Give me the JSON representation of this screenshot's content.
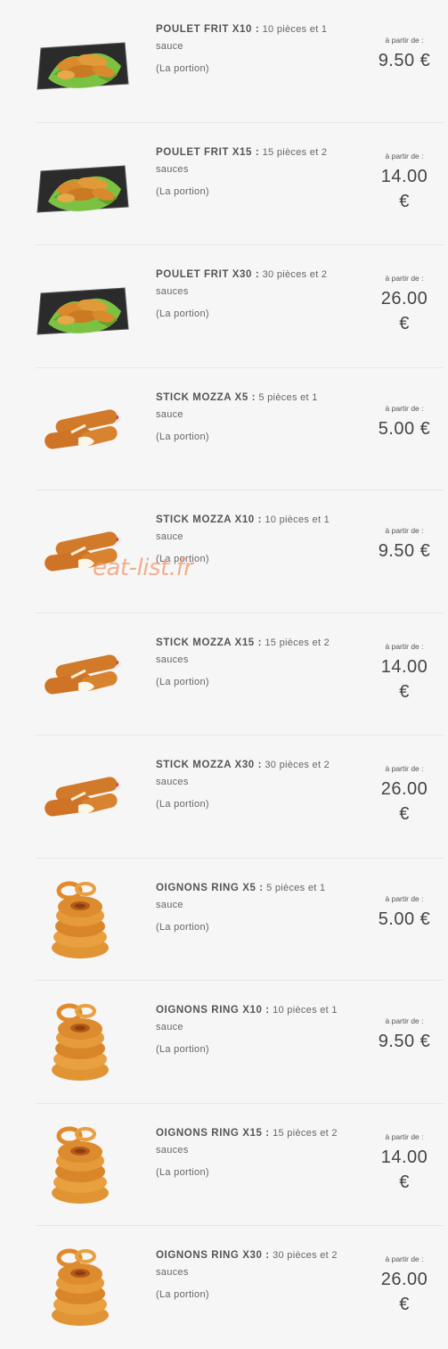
{
  "items": [
    {
      "name": "POULET FRIT X10 :",
      "detail": " 10 pièces et 1 sauce",
      "portion": "(La portion)",
      "from": "à partir de :",
      "price": "9.50 €",
      "image": "fried-chicken"
    },
    {
      "name": "POULET FRIT X15 :",
      "detail": " 15 pièces et 2 sauces",
      "portion": "(La portion)",
      "from": "à partir de :",
      "price": "14.00 €",
      "image": "fried-chicken"
    },
    {
      "name": "POULET FRIT X30 :",
      "detail": " 30 pièces et 2 sauces",
      "portion": "(La portion)",
      "from": "à partir de :",
      "price": "26.00 €",
      "image": "fried-chicken"
    },
    {
      "name": "STICK MOZZA X5 :",
      "detail": " 5 pièces et 1 sauce",
      "portion": "(La portion)",
      "from": "à partir de :",
      "price": "5.00 €",
      "image": "mozza-sticks"
    },
    {
      "name": "STICK MOZZA X10 :",
      "detail": " 10 pièces et 1 sauce",
      "portion": "(La portion)",
      "from": "à partir de :",
      "price": "9.50 €",
      "image": "mozza-sticks"
    },
    {
      "name": "STICK MOZZA X15 :",
      "detail": " 15 pièces et 2 sauces",
      "portion": "(La portion)",
      "from": "à partir de :",
      "price": "14.00 €",
      "image": "mozza-sticks"
    },
    {
      "name": "STICK MOZZA X30 :",
      "detail": " 30 pièces et 2 sauces",
      "portion": "(La portion)",
      "from": "à partir de :",
      "price": "26.00 €",
      "image": "mozza-sticks"
    },
    {
      "name": "OIGNONS RING X5 :",
      "detail": " 5 pièces et 1 sauce",
      "portion": "(La portion)",
      "from": "à partir de :",
      "price": "5.00 €",
      "image": "onion-rings"
    },
    {
      "name": "OIGNONS RING X10 :",
      "detail": " 10 pièces et 1 sauce",
      "portion": "(La portion)",
      "from": "à partir de :",
      "price": "9.50 €",
      "image": "onion-rings"
    },
    {
      "name": "OIGNONS RING X15 :",
      "detail": " 15 pièces et 2 sauces",
      "portion": "(La portion)",
      "from": "à partir de :",
      "price": "14.00 €",
      "image": "onion-rings"
    },
    {
      "name": "OIGNONS RING X30 :",
      "detail": " 30 pièces et 2 sauces",
      "portion": "(La portion)",
      "from": "à partir de :",
      "price": "26.00 €",
      "image": "onion-rings"
    }
  ],
  "watermark": "eat-list.fr"
}
